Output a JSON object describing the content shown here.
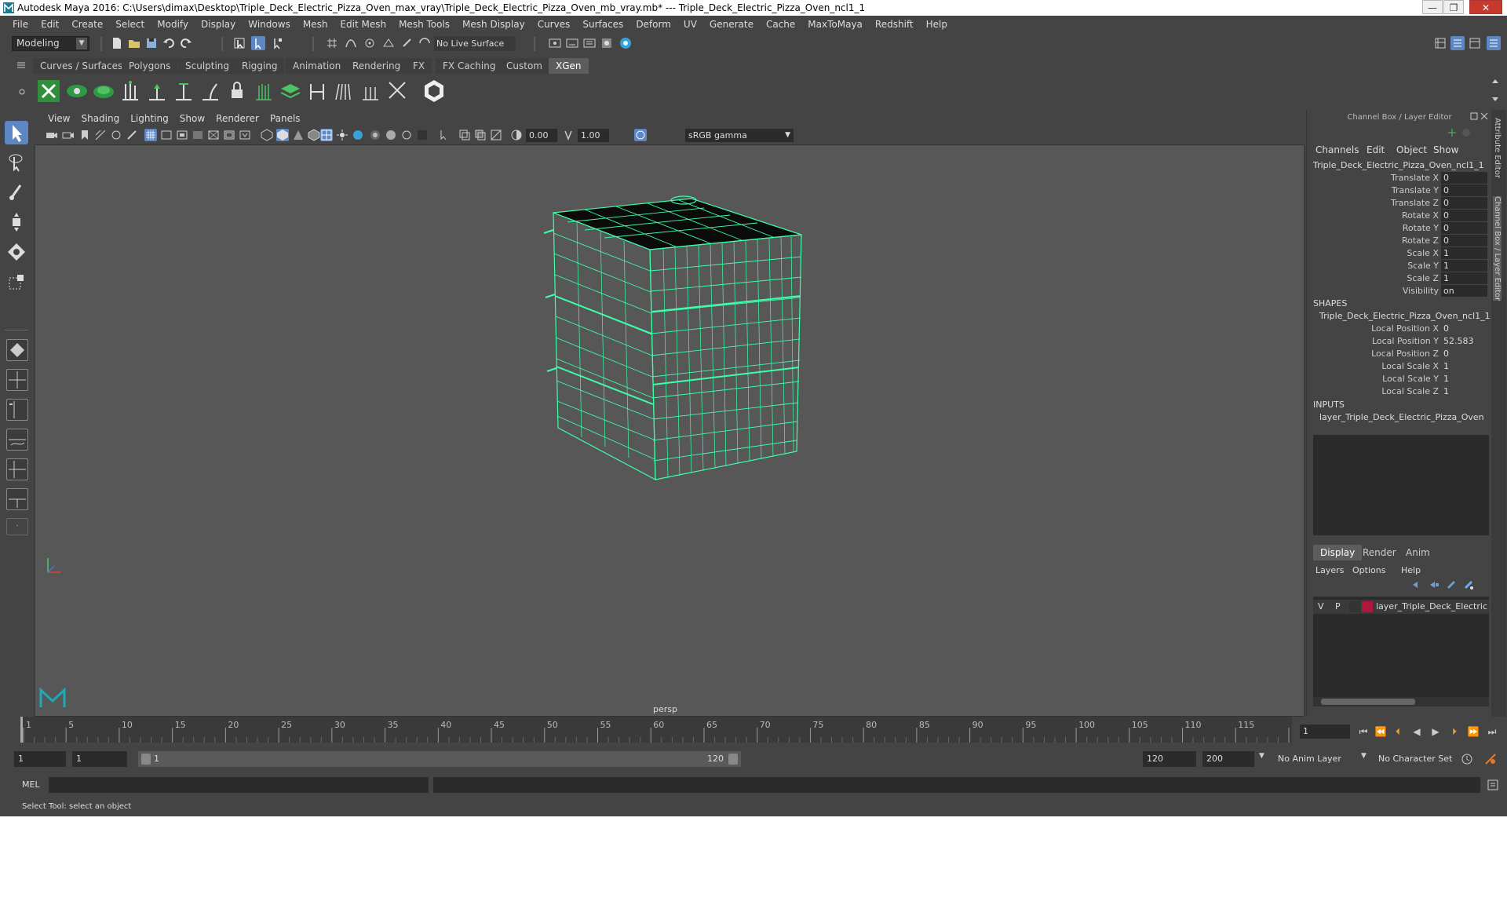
{
  "window": {
    "title": "Autodesk Maya 2016: C:\\Users\\dimax\\Desktop\\Triple_Deck_Electric_Pizza_Oven_max_vray\\Triple_Deck_Electric_Pizza_Oven_mb_vray.mb*   ---   Triple_Deck_Electric_Pizza_Oven_ncl1_1",
    "controls": {
      "minimize": "—",
      "maximize": "❐",
      "close": "✕"
    }
  },
  "menubar": [
    "File",
    "Edit",
    "Create",
    "Select",
    "Modify",
    "Display",
    "Windows",
    "Mesh",
    "Edit Mesh",
    "Mesh Tools",
    "Mesh Display",
    "Curves",
    "Surfaces",
    "Deform",
    "UV",
    "Generate",
    "Cache",
    "MaxToMaya",
    "Redshift",
    "Help"
  ],
  "statusline": {
    "mode": "Modeling",
    "live_surface": "No Live Surface"
  },
  "shelf": {
    "tabs": [
      "Curves / Surfaces",
      "Polygons",
      "Sculpting",
      "Rigging",
      "Animation",
      "Rendering",
      "FX",
      "FX Caching",
      "Custom",
      "XGen"
    ],
    "active_tab": "XGen"
  },
  "viewport": {
    "menu": [
      "View",
      "Shading",
      "Lighting",
      "Show",
      "Renderer",
      "Panels"
    ],
    "exposure": "0.00",
    "gamma": "1.00",
    "color_space": "sRGB gamma",
    "camera": "persp"
  },
  "channelbox": {
    "title": "Channel Box / Layer Editor",
    "menu": [
      "Channels",
      "Edit",
      "Object",
      "Show"
    ],
    "object": "Triple_Deck_Electric_Pizza_Oven_ncl1_1",
    "transform": [
      {
        "label": "Translate X",
        "value": "0"
      },
      {
        "label": "Translate Y",
        "value": "0"
      },
      {
        "label": "Translate Z",
        "value": "0"
      },
      {
        "label": "Rotate X",
        "value": "0"
      },
      {
        "label": "Rotate Y",
        "value": "0"
      },
      {
        "label": "Rotate Z",
        "value": "0"
      },
      {
        "label": "Scale X",
        "value": "1"
      },
      {
        "label": "Scale Y",
        "value": "1"
      },
      {
        "label": "Scale Z",
        "value": "1"
      },
      {
        "label": "Visibility",
        "value": "on"
      }
    ],
    "shapes_header": "SHAPES",
    "shape_name": "Triple_Deck_Electric_Pizza_Oven_ncl1_1...",
    "shape_attrs": [
      {
        "label": "Local Position X",
        "value": "0"
      },
      {
        "label": "Local Position Y",
        "value": "52.583"
      },
      {
        "label": "Local Position Z",
        "value": "0"
      },
      {
        "label": "Local Scale X",
        "value": "1"
      },
      {
        "label": "Local Scale Y",
        "value": "1"
      },
      {
        "label": "Local Scale Z",
        "value": "1"
      }
    ],
    "inputs_header": "INPUTS",
    "input_name": "layer_Triple_Deck_Electric_Pizza_Oven",
    "side_tabs": [
      "Attribute Editor",
      "Channel Box / Layer Editor"
    ]
  },
  "layer_editor": {
    "tabs": [
      "Display",
      "Render",
      "Anim"
    ],
    "active_tab": "Display",
    "menu": [
      "Layers",
      "Options",
      "Help"
    ],
    "layer": {
      "v": "V",
      "p": "P",
      "name": "layer_Triple_Deck_Electric",
      "color": "#b0173a"
    }
  },
  "timeslider": {
    "ticks": [
      1,
      5,
      10,
      15,
      20,
      25,
      30,
      35,
      40,
      45,
      50,
      55,
      60,
      65,
      70,
      75,
      80,
      85,
      90,
      95,
      100,
      105,
      110,
      115,
      120
    ],
    "current_frame": "1",
    "start": 1,
    "end": 120
  },
  "rangeslider": {
    "start_field": "1",
    "anim_start": "1",
    "range_start": "1",
    "range_end": "120",
    "playback_end": "120",
    "anim_end": "200",
    "anim_layer": "No Anim Layer",
    "character_set": "No Character Set"
  },
  "cmdline": {
    "label": "MEL"
  },
  "helpline": {
    "text": "Select Tool: select an object"
  },
  "colors": {
    "wireframe": "#3dffa8",
    "active_tool": "#5c86c4",
    "ui_bg": "#444444",
    "viewport_bg": "#575757"
  }
}
